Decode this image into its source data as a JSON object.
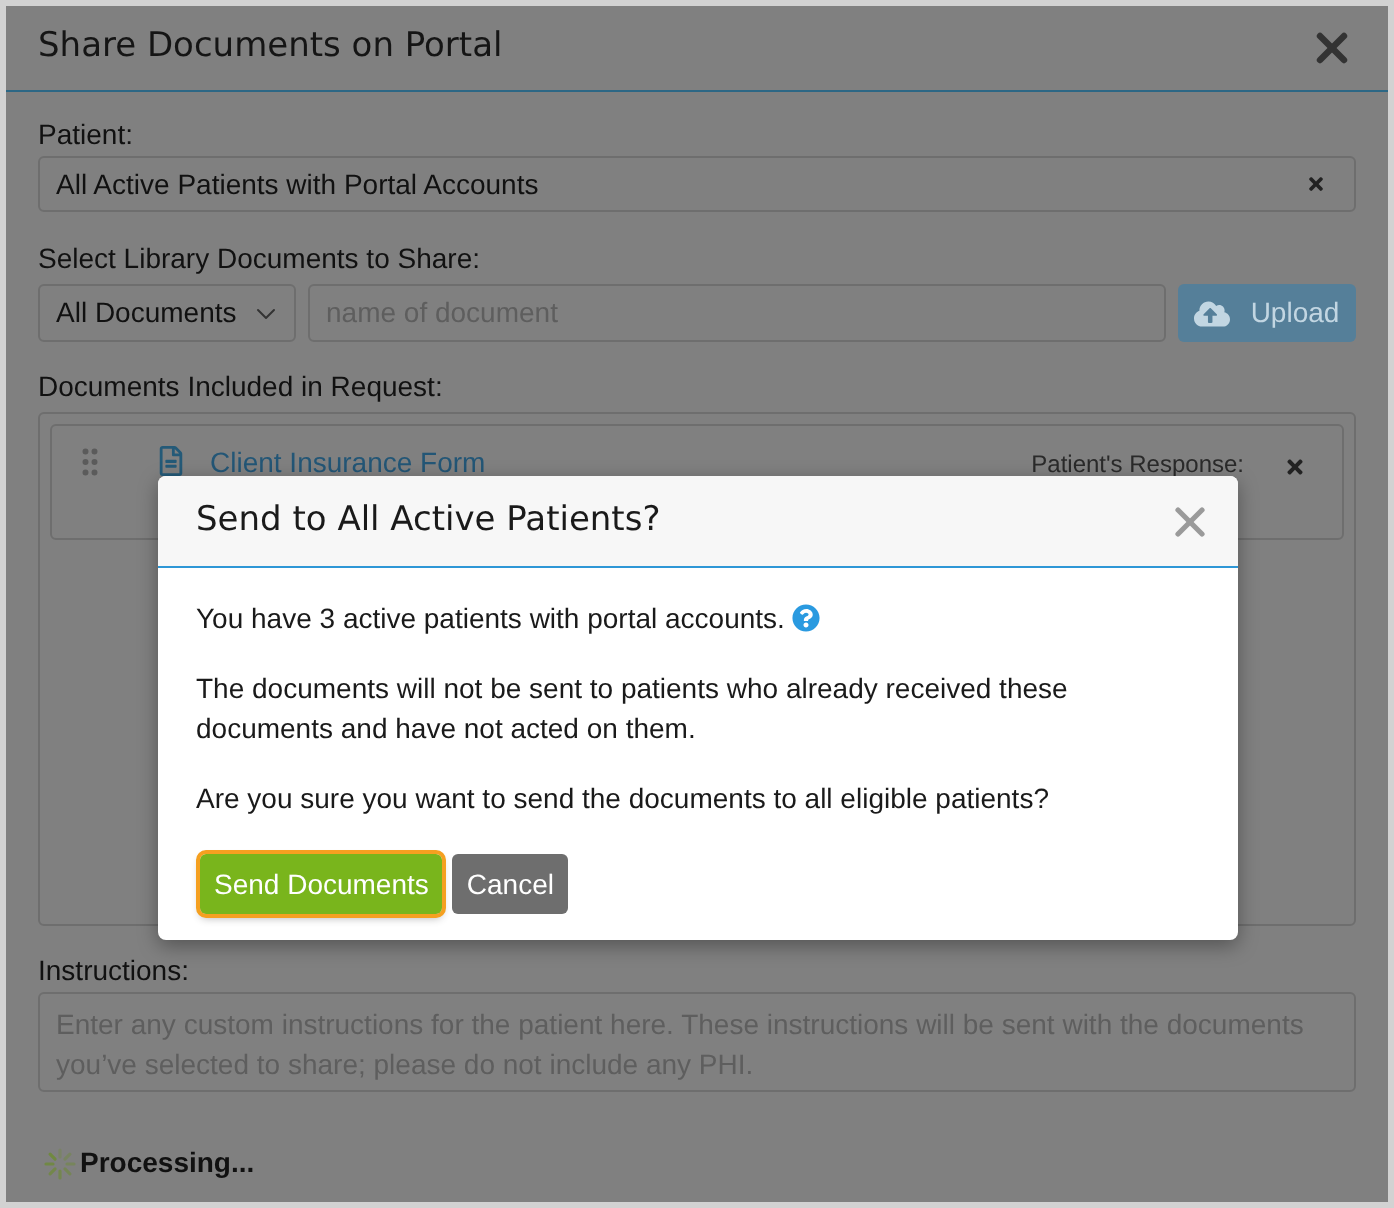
{
  "dialog": {
    "title": "Share Documents on Portal"
  },
  "patient": {
    "label": "Patient:",
    "value": "All Active Patients with Portal Accounts"
  },
  "library": {
    "label": "Select Library Documents to Share:",
    "category": "All Documents",
    "search": {
      "placeholder": "name of document"
    },
    "upload_button": {
      "label": "Upload",
      "disabled": true
    }
  },
  "documents": {
    "label": "Documents Included in Request:",
    "items": [
      {
        "name": "Client Insurance Form",
        "response_label": "Patient's Response:"
      }
    ]
  },
  "instructions": {
    "label": "Instructions:",
    "placeholder": "Enter any custom instructions for the patient here. These instructions will be sent with the documents you’ve selected to share; please do not include any PHI."
  },
  "status": {
    "text": "Processing..."
  },
  "confirm_modal": {
    "title": "Send to All Active Patients?",
    "paragraphs": [
      {
        "text": "You have 3 active patients with portal accounts.",
        "help": true
      },
      {
        "text": "The documents will not be sent to patients who already received these documents and have not acted on them.",
        "help": false
      },
      {
        "text": "Are you sure you want to send the documents to all eligible patients?",
        "help": false
      }
    ],
    "buttons": [
      {
        "label": "Send Documents",
        "kind": "primary",
        "focused": true
      },
      {
        "label": "Cancel",
        "kind": "secondary",
        "focused": false
      }
    ]
  }
}
